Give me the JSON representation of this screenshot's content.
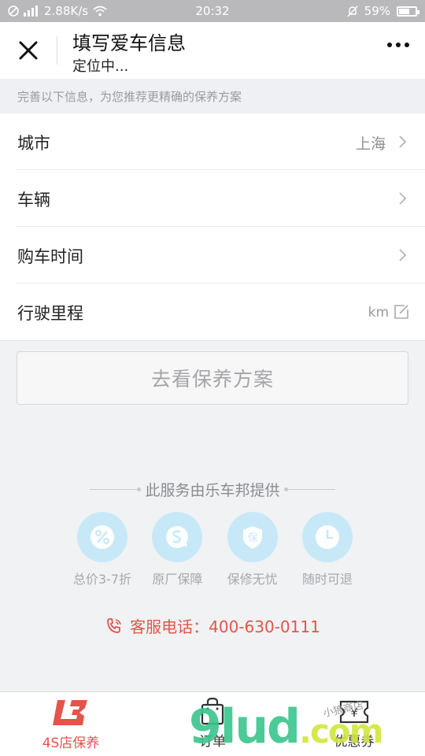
{
  "status_bar": {
    "speed": "2.88K/s",
    "time": "20:32",
    "battery_text": "59%",
    "battery_level": 0.59
  },
  "header": {
    "title": "填写爱车信息",
    "subtitle": "定位中..."
  },
  "hint": "完善以下信息，为您推荐更精确的保养方案",
  "form": {
    "rows": [
      {
        "label": "城市",
        "value": "上海"
      },
      {
        "label": "车辆",
        "value": ""
      },
      {
        "label": "购车时间",
        "value": ""
      },
      {
        "label": "行驶里程",
        "unit": "km"
      }
    ]
  },
  "cta_label": "去看保养方案",
  "provider_text": "此服务由乐车邦提供",
  "features": [
    {
      "label": "总价3-7折",
      "icon": "percent-icon"
    },
    {
      "label": "原厂保障",
      "icon": "s-chat-icon"
    },
    {
      "label": "保修无忧",
      "icon": "shield-icon"
    },
    {
      "label": "随时可退",
      "icon": "clock-icon"
    }
  ],
  "phone_text": "客服电话：400-630-0111",
  "tabs": [
    {
      "label": "4S店保养",
      "icon": "lcb-logo-icon",
      "active": true
    },
    {
      "label": "订单",
      "icon": "bag-icon",
      "active": false
    },
    {
      "label": "优惠券",
      "icon": "coupon-icon",
      "active": false
    }
  ],
  "watermark": {
    "text": "9lud",
    "suffix": ".com",
    "small": "小狼商店"
  },
  "colors": {
    "accent": "#e2554a",
    "feature_circle": "#c7e9f7",
    "feature_icon": "#ffffff"
  }
}
